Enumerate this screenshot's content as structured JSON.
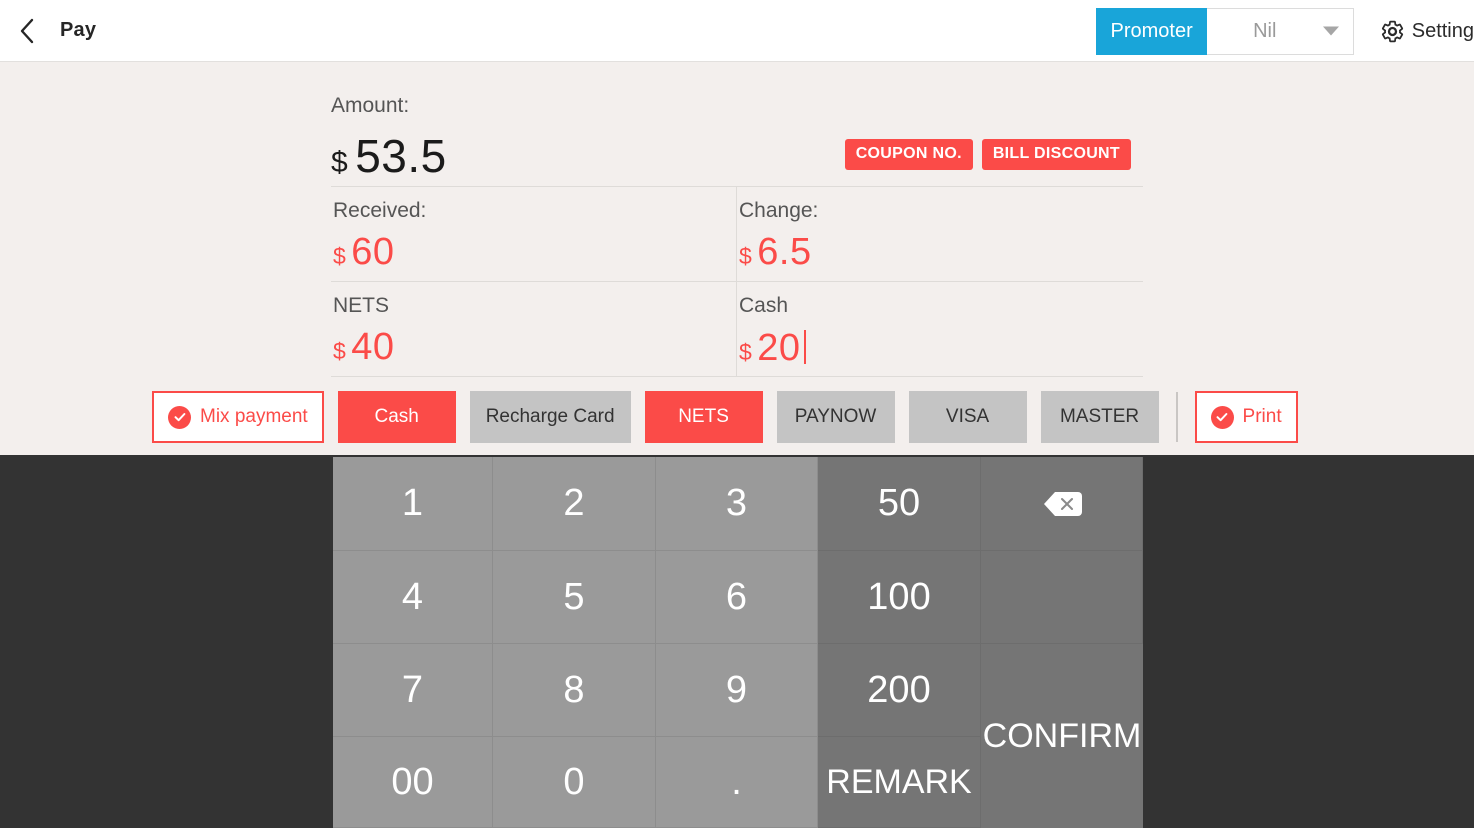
{
  "header": {
    "back_icon": "chevron-left-icon",
    "title": "Pay",
    "promoter_label": "Promoter",
    "promoter_value": "Nil",
    "promoter_caret_icon": "chevron-down-icon",
    "setting_icon": "gear-icon",
    "setting_label": "Setting",
    "promoter_color": "#19A5D9"
  },
  "payment": {
    "amount_label": "Amount:",
    "amount_currency": "$",
    "amount_value": "53.5",
    "coupon_button": "COUPON NO.",
    "bill_discount_button": "BILL DISCOUNT",
    "received_label": "Received:",
    "received_currency": "$",
    "received_value": "60",
    "change_label": "Change:",
    "change_currency": "$",
    "change_value": "6.5",
    "nets_label": "NETS",
    "nets_currency": "$",
    "nets_value": "40",
    "cash_label": "Cash",
    "cash_currency": "$",
    "cash_value": "20",
    "accent_red": "#fb4b48",
    "amount_text_color": "#1b1b1b"
  },
  "methods": {
    "mix_payment_label": "Mix payment",
    "mix_payment_checked": true,
    "print_label": "Print",
    "print_checked": true,
    "check_icon": "check-circle-icon",
    "buttons": [
      {
        "label": "Cash",
        "active": true
      },
      {
        "label": "Recharge Card",
        "active": false
      },
      {
        "label": "NETS",
        "active": true
      },
      {
        "label": "PAYNOW",
        "active": false
      },
      {
        "label": "VISA",
        "active": false
      },
      {
        "label": "MASTER",
        "active": false
      }
    ]
  },
  "keypad": {
    "keys": [
      {
        "label": "1",
        "style": "light"
      },
      {
        "label": "2",
        "style": "light"
      },
      {
        "label": "3",
        "style": "light"
      },
      {
        "label": "50",
        "style": "dark"
      },
      {
        "label": "4",
        "style": "light"
      },
      {
        "label": "5",
        "style": "light"
      },
      {
        "label": "6",
        "style": "light"
      },
      {
        "label": "100",
        "style": "dark"
      },
      {
        "label": "7",
        "style": "light"
      },
      {
        "label": "8",
        "style": "light"
      },
      {
        "label": "9",
        "style": "light"
      },
      {
        "label": "200",
        "style": "dark"
      },
      {
        "label": "00",
        "style": "light"
      },
      {
        "label": "0",
        "style": "light"
      },
      {
        "label": ".",
        "style": "light"
      },
      {
        "label": "REMARK",
        "style": "dark"
      }
    ],
    "backspace_icon": "backspace-icon",
    "confirm_label": "CONFIRM"
  }
}
